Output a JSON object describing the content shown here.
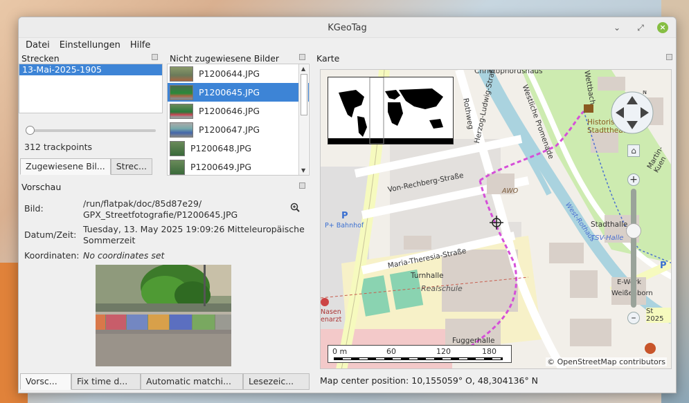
{
  "window": {
    "title": "KGeoTag"
  },
  "menu": {
    "file": "Datei",
    "settings": "Einstellungen",
    "help": "Hilfe"
  },
  "tracks": {
    "header": "Strecken",
    "items": [
      "13-Mai-2025-1905"
    ],
    "trackpoints": "312 trackpoints",
    "tabs": [
      "Zugewiesene Bil...",
      "Strec..."
    ]
  },
  "unassigned": {
    "header": "Nicht zugewiesene Bilder",
    "items": [
      "P1200644.JPG",
      "P1200645.JPG",
      "P1200646.JPG",
      "P1200647.JPG",
      "P1200648.JPG",
      "P1200649.JPG"
    ],
    "selected_index": 1
  },
  "preview": {
    "header": "Vorschau",
    "image_label": "Bild:",
    "image_path_line1": "/run/flatpak/doc/85d87e29/",
    "image_path_line2": "GPX_Streetfotografie/P1200645.JPG",
    "datetime_label": "Datum/Zeit:",
    "datetime_line1": "Tuesday, 13. May 2025 19:09:26 Mitteleuropäische",
    "datetime_line2": "Sommerzeit",
    "coords_label": "Koordinaten:",
    "coords_value": "No coordinates set"
  },
  "bottom_tabs": [
    "Vorsc...",
    "Fix time d...",
    "Automatic matchi...",
    "Lesezeic..."
  ],
  "map": {
    "header": "Karte",
    "streets": [
      "Christophorushaus",
      "Rothweg",
      "Herzog-Ludwig-Straße",
      "Westliche Promenade",
      "Von-Rechberg-Straße",
      "Maria-Theresia-Straße",
      "Wettbach",
      "Historisches Stadttheater",
      "Stadthalle",
      "TSV-Halle",
      "Turnhalle",
      "Realschule",
      "Fuggerhalle",
      "AWO",
      "Weißenborn",
      "E-Werk",
      "St 2025",
      "Martin-Kuen",
      "West-Rothaus"
    ],
    "scale_labels": [
      "0 m",
      "60",
      "120",
      "180"
    ],
    "attribution": "© OpenStreetMap contributors",
    "status": "Map center position: 10,155059° O, 48,304136° N"
  }
}
